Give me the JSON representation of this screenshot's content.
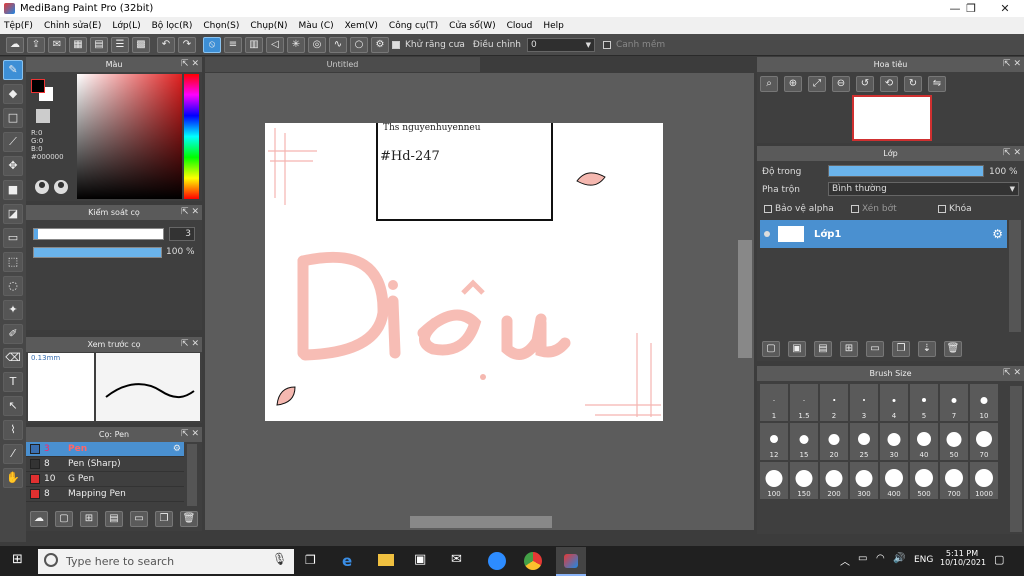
{
  "window": {
    "title": "MediBang Paint Pro (32bit)"
  },
  "menu": [
    "Tệp(F)",
    "Chỉnh sửa(E)",
    "Lớp(L)",
    "Bộ lọc(R)",
    "Chọn(S)",
    "Chụp(N)",
    "Màu (C)",
    "Xem(V)",
    "Công cụ(T)",
    "Cửa sổ(W)",
    "Cloud",
    "Help"
  ],
  "toolbar": {
    "antialias_label": "Khử răng cưa",
    "adjust_label": "Điều chỉnh",
    "adjust_value": "0",
    "snap_label": "Canh mềm"
  },
  "color_panel": {
    "title": "Màu",
    "r": "R:0",
    "g": "G:0",
    "b": "B:0",
    "hex": "#000000"
  },
  "brush_control": {
    "title": "Kiểm soát cọ",
    "size": "3",
    "opacity": "100 %"
  },
  "preview": {
    "title": "Xem trước cọ",
    "size": "0.13mm"
  },
  "brush_list": {
    "title": "Cọ: Pen",
    "items": [
      {
        "num": "3",
        "name": "Pen",
        "color": "#3a6fb0"
      },
      {
        "num": "8",
        "name": "Pen (Sharp)",
        "color": "#333333"
      },
      {
        "num": "10",
        "name": "G Pen",
        "color": "#e03030"
      },
      {
        "num": "8",
        "name": "Mapping Pen",
        "color": "#e03030"
      }
    ]
  },
  "document": {
    "tab": "Untitled",
    "caption": "Ths nguyenhuyenneu",
    "hashtag": "#Hd-247",
    "title_art": "Diêu"
  },
  "navigator": {
    "title": "Hoa tiêu"
  },
  "layers": {
    "title": "Lớp",
    "opacity_label": "Độ trong",
    "opacity_value": "100 %",
    "opacity_fraction": 1.0,
    "blend_label": "Pha trộn",
    "blend_value": "Bình thường",
    "protect_alpha": "Bảo vệ alpha",
    "clipping": "Xén bớt",
    "lock": "Khóa",
    "layer_name": "Lớp1"
  },
  "brush_size": {
    "title": "Brush Size",
    "sizes": [
      "1",
      "1.5",
      "2",
      "3",
      "4",
      "5",
      "7",
      "10",
      "12",
      "15",
      "20",
      "25",
      "30",
      "40",
      "50",
      "70",
      "100",
      "150",
      "200",
      "300",
      "400",
      "500",
      "700",
      "1000"
    ]
  },
  "taskbar": {
    "search_placeholder": "Type here to search",
    "lang": "ENG",
    "time": "5:11 PM",
    "date": "10/10/2021"
  }
}
